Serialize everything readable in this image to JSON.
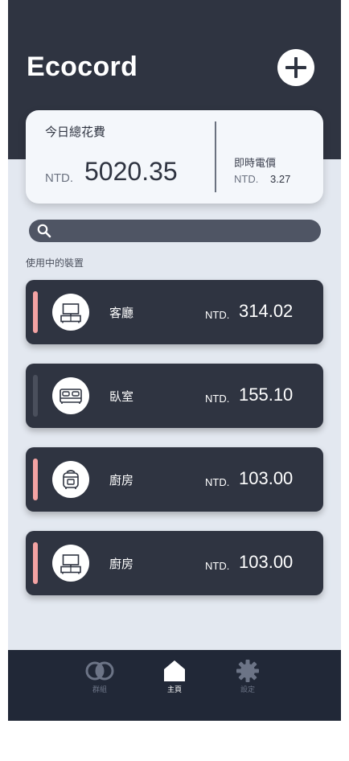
{
  "app": {
    "title": "Ecocord"
  },
  "header": {
    "add_icon": "plus-icon"
  },
  "summary": {
    "title": "今日總花費",
    "currency": "NTD.",
    "total": "5020.35",
    "realtime_title": "即時電價",
    "realtime_currency": "NTD.",
    "realtime_price": "3.27"
  },
  "search": {
    "icon": "search-icon",
    "placeholder": ""
  },
  "section": {
    "label": "使用中的裝置"
  },
  "devices": [
    {
      "name": "客廳",
      "currency": "NTD.",
      "cost": "314.02",
      "icon": "tv-cabinet-icon",
      "active": true
    },
    {
      "name": "臥室",
      "currency": "NTD.",
      "cost": "155.10",
      "icon": "bed-icon",
      "active": false
    },
    {
      "name": "廚房",
      "currency": "NTD.",
      "cost": "103.00",
      "icon": "rice-cooker-icon",
      "active": true
    },
    {
      "name": "廚房",
      "currency": "NTD.",
      "cost": "103.00",
      "icon": "tv-cabinet-icon",
      "active": true
    }
  ],
  "tabbar": {
    "items": [
      {
        "label": "群組",
        "icon": "group-rings-icon",
        "selected": false
      },
      {
        "label": "主頁",
        "icon": "home-icon",
        "selected": true
      },
      {
        "label": "設定",
        "icon": "gear-icon",
        "selected": false
      }
    ]
  },
  "colors": {
    "dark": "#2f3441",
    "background": "#e3e8f0",
    "tabbar": "#212837",
    "active_indicator": "#f4a3a3",
    "inactive_indicator": "#4a4f5c",
    "tab_inactive": "#6c7486"
  }
}
